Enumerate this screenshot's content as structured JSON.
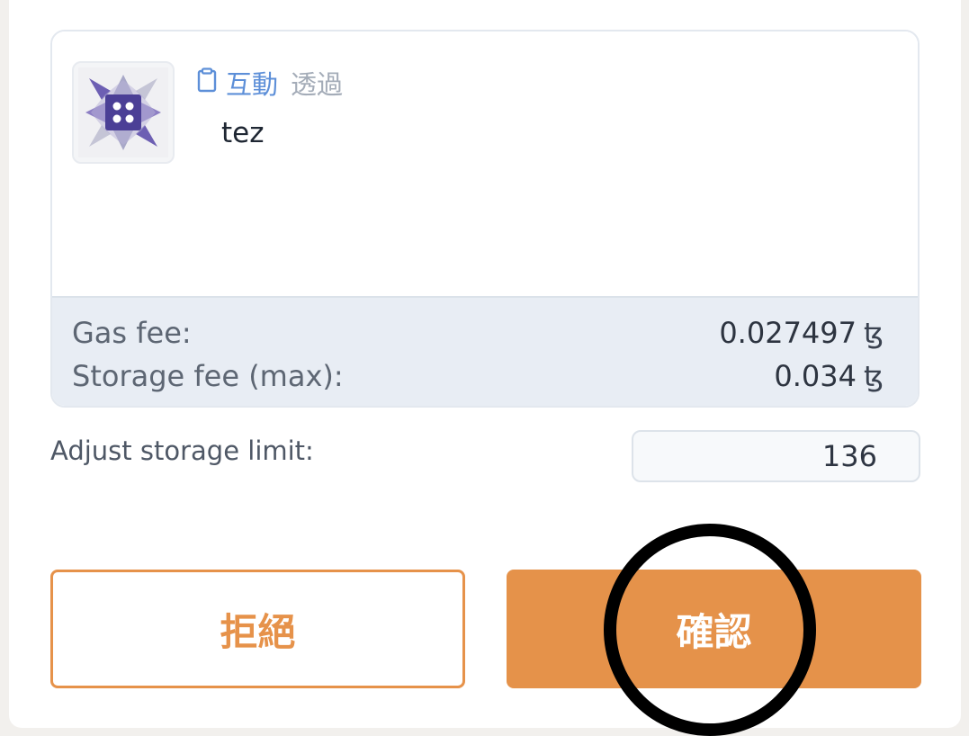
{
  "operation": {
    "avatar_icon": "grid-star-logo-icon",
    "copy_icon": "clipboard-icon",
    "interact_label": "互動",
    "via_label": "透過",
    "asset": "tez"
  },
  "fees": {
    "gas_label": "Gas fee:",
    "gas_value": "0.027497",
    "storage_label": "Storage fee (max):",
    "storage_value": "0.034",
    "unit": "ꜩ"
  },
  "storage": {
    "label": "Adjust storage limit:",
    "value": "136"
  },
  "actions": {
    "reject_label": "拒絕",
    "confirm_label": "確認"
  },
  "colors": {
    "accent": "#e5924a",
    "link": "#5d8fd8"
  }
}
